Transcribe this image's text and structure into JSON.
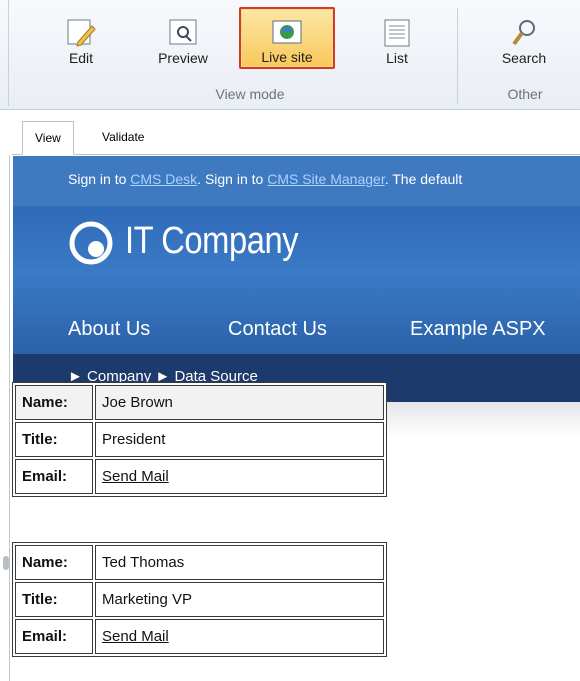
{
  "toolbar": {
    "buttons": [
      {
        "label": "Edit"
      },
      {
        "label": "Preview"
      },
      {
        "label": "Live site"
      },
      {
        "label": "List"
      },
      {
        "label": "Search"
      }
    ],
    "groups": {
      "view_mode": "View mode",
      "other": "Other"
    }
  },
  "tabs": [
    {
      "label": "View"
    },
    {
      "label": "Validate"
    }
  ],
  "site": {
    "signin": {
      "prefix": "Sign in to ",
      "link1": "CMS Desk",
      "middle": ". Sign in to ",
      "link2": "CMS Site Manager",
      "suffix": ". The default"
    },
    "logo_text": "IT Company",
    "nav": [
      {
        "label": "About Us"
      },
      {
        "label": "Contact Us"
      },
      {
        "label": "Example ASPX"
      }
    ],
    "breadcrumb": {
      "arrow": "►",
      "items": [
        "Company",
        "Data Source"
      ]
    }
  },
  "records": [
    {
      "name_label": "Name:",
      "name": "Joe Brown",
      "title_label": "Title:",
      "title": "President",
      "email_label": "Email:",
      "email": "Send Mail"
    },
    {
      "name_label": "Name:",
      "name": "Ted Thomas",
      "title_label": "Title:",
      "title": "Marketing VP",
      "email_label": "Email:",
      "email": "Send Mail"
    }
  ],
  "colors": {
    "accent": "#3f7ac0",
    "header_dark": "#1c3a6b",
    "active_border": "#d23a27",
    "active_fill": "#f9c85b"
  }
}
